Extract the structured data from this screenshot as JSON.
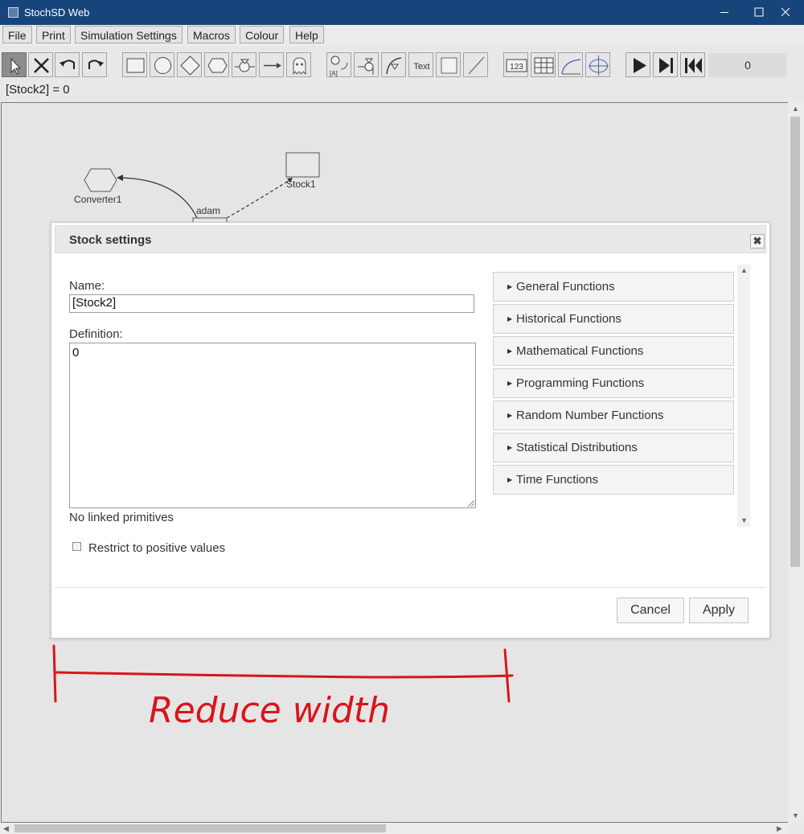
{
  "window": {
    "title": "StochSD Web",
    "minimize_icon": "minimize-icon",
    "maximize_icon": "maximize-icon",
    "close_icon": "close-icon"
  },
  "menu": [
    "File",
    "Print",
    "Simulation Settings",
    "Macros",
    "Colour",
    "Help"
  ],
  "toolbar": {
    "time_value": "0",
    "text_tool_label": "Text",
    "number_tool_label": "123",
    "ghost_tool_label": "[A]"
  },
  "status": "[Stock2] = 0",
  "model": {
    "converter_label": "Converter1",
    "stock1_label": "Stock1",
    "flow_label": "adam"
  },
  "dialog": {
    "title": "Stock settings",
    "close_symbol": "✖",
    "name_label": "Name:",
    "name_value": "[Stock2]",
    "definition_label": "Definition:",
    "definition_value": "0",
    "linked_text": "No linked primitives",
    "restrict_label": "Restrict to positive values",
    "restrict_checked": false,
    "functions": [
      "General Functions",
      "Historical Functions",
      "Mathematical Functions",
      "Programming Functions",
      "Random Number Functions",
      "Statistical Distributions",
      "Time Functions"
    ],
    "cancel_label": "Cancel",
    "apply_label": "Apply"
  },
  "annotation": {
    "text": "Reduce width",
    "color": "#d9141b"
  },
  "colors": {
    "titlebar": "#17457b",
    "canvas": "#e5e5e5"
  }
}
